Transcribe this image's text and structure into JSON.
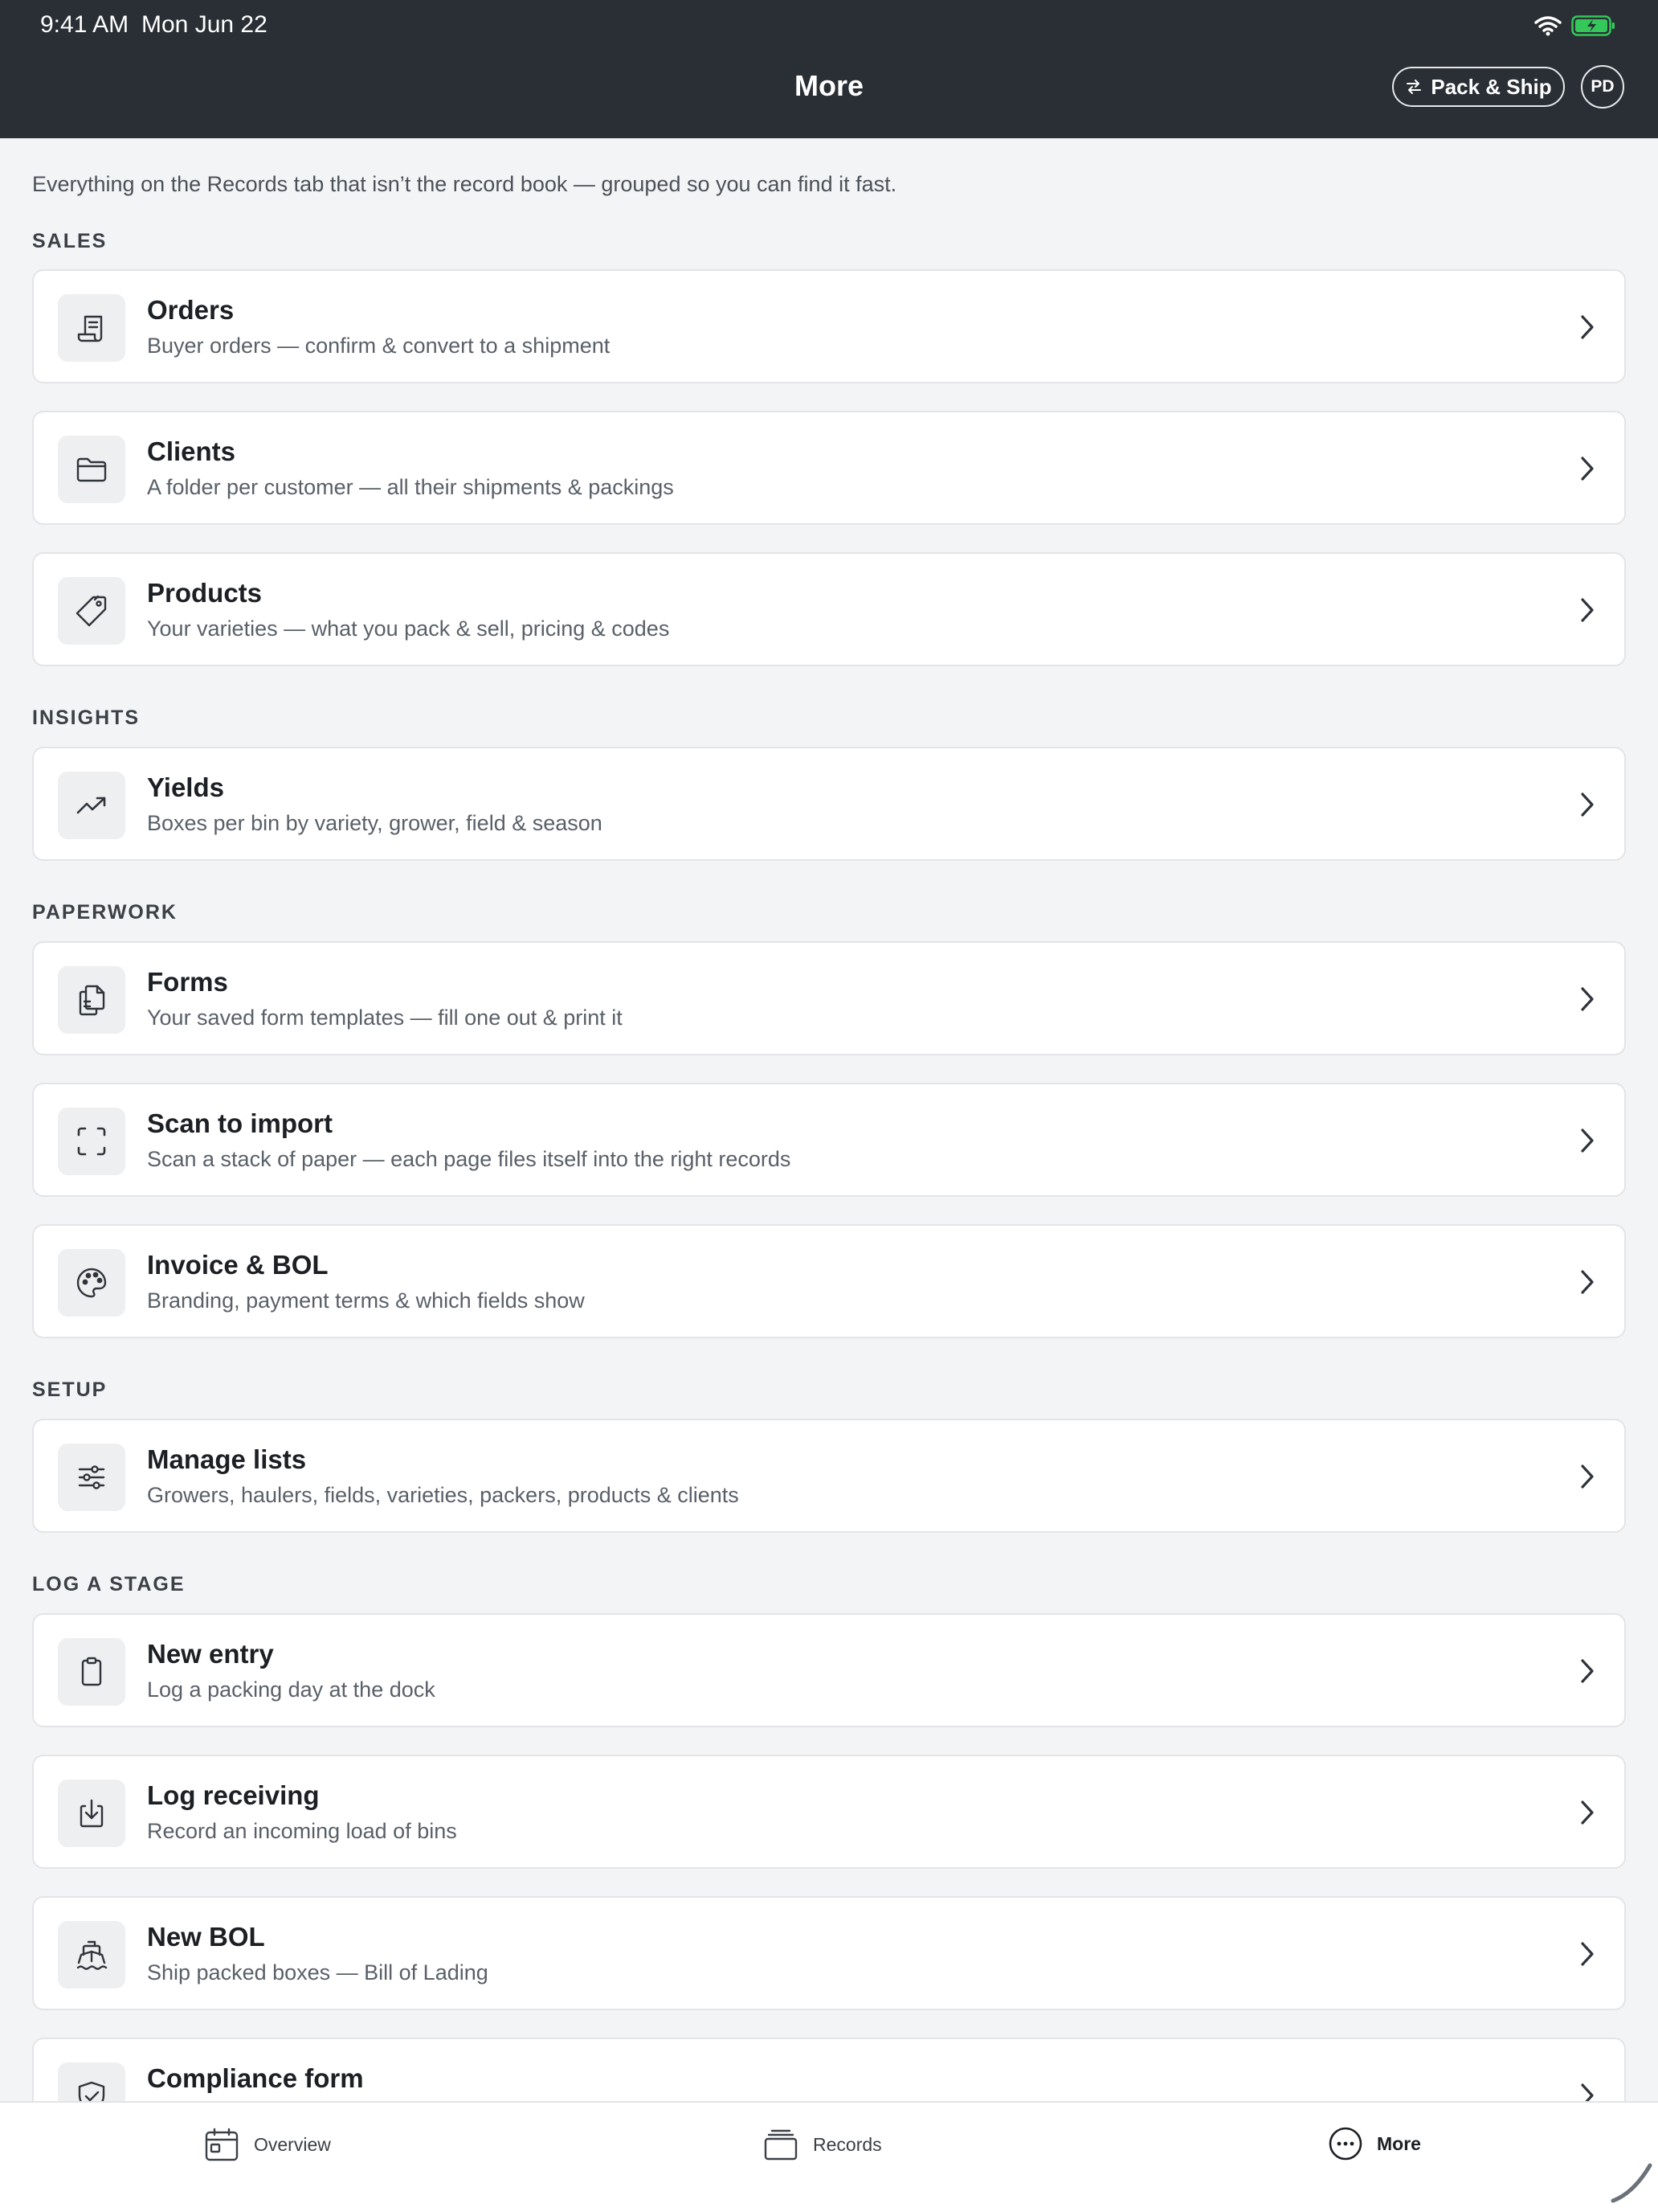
{
  "status_bar": {
    "time": "9:41 AM",
    "date": "Mon Jun 22"
  },
  "header": {
    "title": "More",
    "pack_ship_label": "Pack & Ship",
    "avatar_initials": "PD"
  },
  "intro": "Everything on the Records tab that isn’t the record book — grouped so you can find it fast.",
  "sections": {
    "sales": {
      "label": "SALES",
      "items": [
        {
          "title": "Orders",
          "subtitle": "Buyer orders — confirm & convert to a shipment",
          "icon": "receipt-icon"
        },
        {
          "title": "Clients",
          "subtitle": "A folder per customer — all their shipments & packings",
          "icon": "folder-icon"
        },
        {
          "title": "Products",
          "subtitle": "Your varieties — what you pack & sell, pricing & codes",
          "icon": "tag-icon"
        }
      ]
    },
    "insights": {
      "label": "INSIGHTS",
      "items": [
        {
          "title": "Yields",
          "subtitle": "Boxes per bin by variety, grower, field & season",
          "icon": "trending-up-icon"
        }
      ]
    },
    "paperwork": {
      "label": "PAPERWORK",
      "items": [
        {
          "title": "Forms",
          "subtitle": "Your saved form templates — fill one out & print it",
          "icon": "documents-icon"
        },
        {
          "title": "Scan to import",
          "subtitle": "Scan a stack of paper — each page files itself into the right records",
          "icon": "scan-icon"
        },
        {
          "title": "Invoice & BOL",
          "subtitle": "Branding, payment terms & which fields show",
          "icon": "palette-icon"
        }
      ]
    },
    "setup": {
      "label": "SETUP",
      "items": [
        {
          "title": "Manage lists",
          "subtitle": "Growers, haulers, fields, varieties, packers, products & clients",
          "icon": "sliders-icon"
        }
      ]
    },
    "log_stage": {
      "label": "LOG A STAGE",
      "items": [
        {
          "title": "New entry",
          "subtitle": "Log a packing day at the dock",
          "icon": "clipboard-icon"
        },
        {
          "title": "Log receiving",
          "subtitle": "Record an incoming load of bins",
          "icon": "download-icon"
        },
        {
          "title": "New BOL",
          "subtitle": "Ship packed boxes — Bill of Lading",
          "icon": "ship-icon"
        },
        {
          "title": "Compliance form",
          "subtitle": "",
          "icon": "shield-check-icon"
        }
      ]
    }
  },
  "bottom_nav": [
    {
      "label": "Overview",
      "icon": "calendar-icon"
    },
    {
      "label": "Records",
      "icon": "stack-icon"
    },
    {
      "label": "More",
      "icon": "more-circle-icon"
    }
  ],
  "colors": {
    "header_bg": "#2a2f35",
    "page_bg": "#f3f4f6",
    "card_bg": "#ffffff",
    "battery_green": "#34c759"
  }
}
